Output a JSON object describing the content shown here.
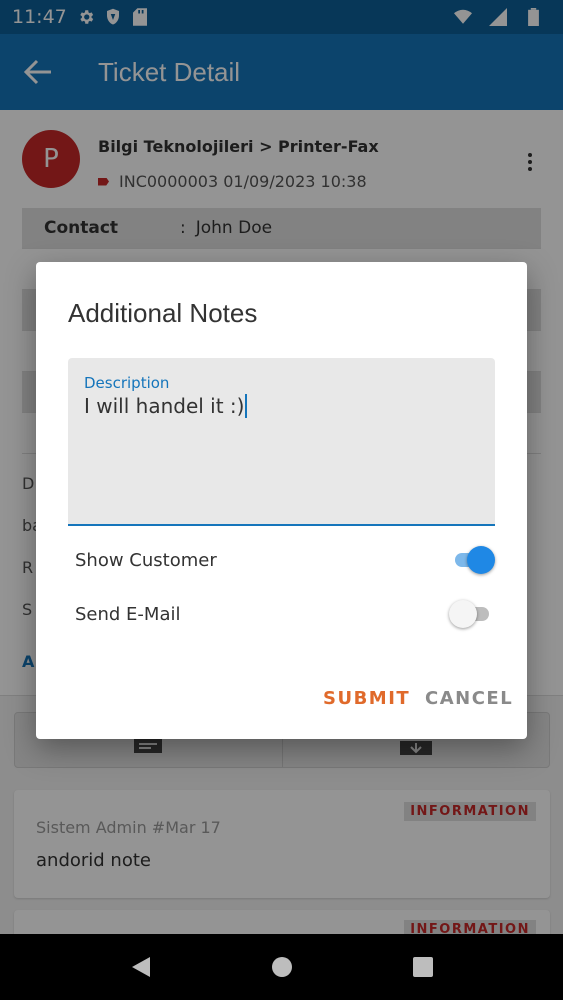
{
  "status_bar": {
    "time": "11:47"
  },
  "app_bar": {
    "title": "Ticket Detail"
  },
  "ticket": {
    "avatar_letter": "P",
    "path": "Bilgi Teknolojileri > Printer-Fax",
    "number_date": "INC0000003 01/09/2023 10:38",
    "contact_label": "Contact",
    "contact_sep": ":",
    "contact_value": "John Doe",
    "frag_1": "D",
    "frag_2": "ba",
    "frag_3": "R",
    "frag_4": "S",
    "frag_5": "A"
  },
  "notes": [
    {
      "author": "Sistem Admin #Mar 17",
      "text": "andorid note",
      "badge": "INFORMATION"
    },
    {
      "badge": "INFORMATION"
    }
  ],
  "dialog": {
    "title": "Additional Notes",
    "description_label": "Description",
    "description_value": "I will handel it :)",
    "show_customer_label": "Show Customer",
    "show_customer_on": true,
    "send_email_label": "Send E-Mail",
    "send_email_on": false,
    "submit_label": "SUBMIT",
    "cancel_label": "CANCEL"
  },
  "colors": {
    "primary": "#1575bb",
    "accent": "#e06a2b",
    "avatar": "#c62828"
  }
}
